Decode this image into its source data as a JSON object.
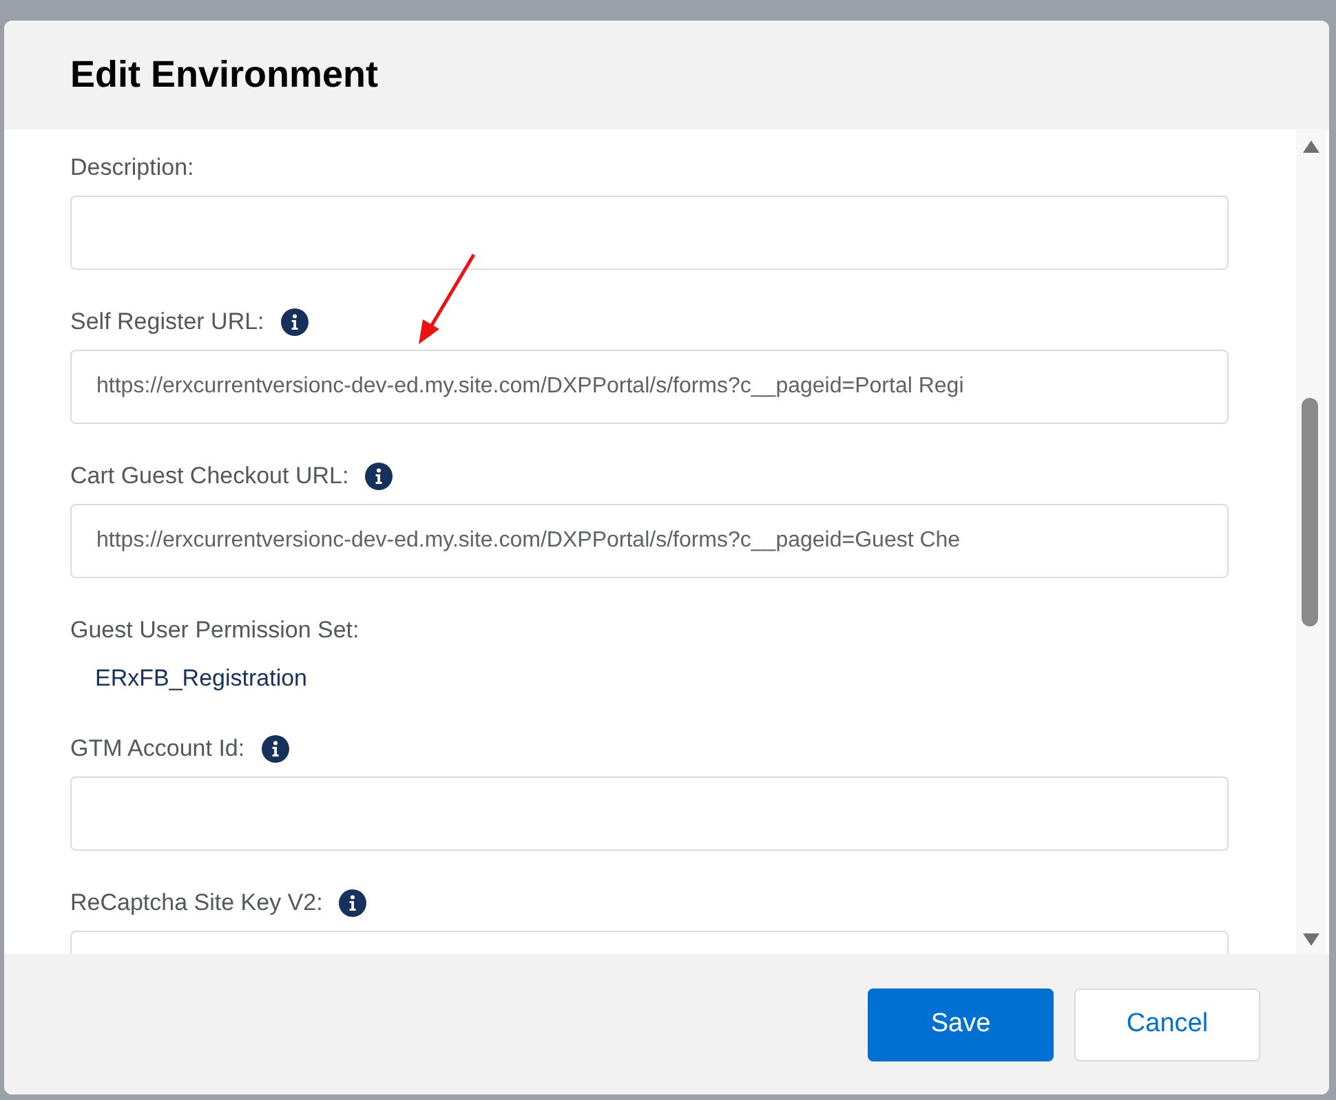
{
  "dialog": {
    "title": "Edit Environment"
  },
  "fields": [
    {
      "kind": "input",
      "label": "Description:",
      "info": false
    },
    {
      "kind": "input",
      "label": "Self Register URL:",
      "info": true,
      "value": "https://erxcurrentversionc-dev-ed.my.site.com/DXPPortal/s/forms?c__pageid=Portal Regi"
    },
    {
      "kind": "input",
      "label": "Cart Guest Checkout URL:",
      "info": true,
      "value": "https://erxcurrentversionc-dev-ed.my.site.com/DXPPortal/s/forms?c__pageid=Guest Che"
    },
    {
      "kind": "text",
      "label": "Guest User Permission Set:",
      "info": false,
      "value": "ERxFB_Registration"
    },
    {
      "kind": "input",
      "label": "GTM Account Id:",
      "info": true
    },
    {
      "kind": "input",
      "label": "ReCaptcha Site Key V2:",
      "info": true
    }
  ],
  "buttons": [
    {
      "label": "Save",
      "kind": "primary"
    },
    {
      "label": "Cancel",
      "kind": "secondary"
    }
  ]
}
